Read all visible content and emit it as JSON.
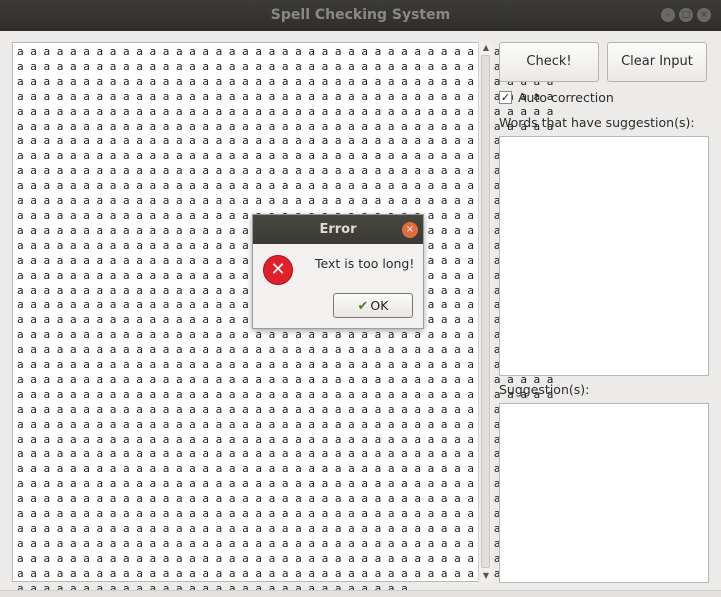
{
  "window": {
    "title": "Spell Checking System",
    "controls": [
      "minimize-icon",
      "maximize-icon",
      "close-icon"
    ]
  },
  "input": {
    "lines": [
      "a a a a a a a a a a a a a a a a a a a a a a a a a a a a a a a a a a a a a a a a a",
      "a a a a a a a a a a a a a a a a a a a a a a a a a a a a a a a a a a a a a a a a a",
      "a a a a a a a a a a a a a a a a a a a a a a a a a a a a a a a a a a a a a a a a a",
      "a a a a a a a a a a a a a a a a a a a a a a a a a a a a a a a a a a a a a a a a a",
      "a a a a a a a a a a a a a a a a a a a a a a a a a a a a a a a a a a a a a a a a a",
      "a a a a a a a a a a a a a a a a a a a a a a a a a a a a a a a a a a a a a a a a a",
      "a a a a a a a a a a a a a a a a a a a a a a a a a a a a a a a a a a a a a a a a a",
      "a a a a a a a a a a a a a a a a a a a a a a a a a a a a a a a a a a a a a a a a a",
      "a a a a a a a a a a a a a a a a a a a a a a a a a a a a a a a a a a a a a a a a a",
      "a a a a a a a a a a a a a a a a a a a a a a a a a a a a a a a a a a a a a a a a a",
      "a a a a a a a a a a a a a a a a a a a a a a a a a a a a a a a a a a a a a a a a a",
      "a a a a a a a a a a a a a a a a a a a a a a a a a a a a a a a a a a a a a a a a a",
      "a a a a a a a a a a a a a a a a a a a a a a a a a a a a a a a a a a a a a a a a a",
      "a a a a a a a a a a a a a a a a a a a a a a a a a a a a a a a a a a a a a a a a a",
      "a a a a a a a a a a a a a a a a a a a a a a a a a a a a a a a a a a a a a a a a a",
      "a a a a a a a a a a a a a a a a a a a a a a a a a a a a a a a a a a a a a a a a a",
      "a a a a a a a a a a a a a a a a a a a a a a a a a a a a a a a a a a a a a a a a a",
      "a a a a a a a a a a a a a a a a a a a a a a a a a a a a a a a a a a a a a a a a a",
      "a a a a a a a a a a a a a a a a a a a a a a a a a a a a a a a a a a a a a a a a a",
      "a a a a a a a a a a a a a a a a a a a a a a a a a a a a a a a a a a a a a a a a a",
      "a a a a a a a a a a a a a a a a a a a a a a a a a a a a a a a a a a a a a a a a a",
      "a a a a a a a a a a a a a a a a a a a a a a a a a a a a a a a a a a a a a a a a a",
      "a a a a a a a a a a a a a a a a a a a a a a a a a a a a a a a a a a a a a a a a a",
      "a a a a a a a a a a a a a a a a a a a a a a a a a a a a a a a a a a a a a a a a a",
      "a a a a a a a a a a a a a a a a a a a a a a a a a a a a a a a a a a a a a a a a a",
      "a a a a a a a a a a a a a a a a a a a a a a a a a a a a a a a a a a a a a a a a a",
      "a a a a a a a a a a a a a a a a a a a a a a a a a a a a a a a a a a a a a a a a a",
      "a a a a a a a a a a a a a a a a a a a a a a a a a a a a a a a a a a a a a a a a a",
      "a a a a a a a a a a a a a a a a a a a a a a a a a a a a a a a a a a a a a a a a a",
      "a a a a a a a a a a a a a a a a a a a a a a a a a a a a a a a a a a a a a a a a a",
      "a a a a a a a a a a a a a a a a a a a a a a a a a a a a a a a a a a a a a a a a a",
      "a a a a a a a a a a a a a a a a a a a a a a a a a a a a a a a a a a a a a a a a a",
      "a a a a a a a a a a a a a a a a a a a a a a a a a a a a a a a a a a a a a a a a a",
      "a a a a a a a a a a a a a a a a a a a a a a a a a a a a a a a a a a a a a a a a a",
      "a a a a a a a a a a a a a a a a a a a a a a a a a a a a a a a a a a a a a a a a a",
      "a a a a a a a a a a a a a a a a a a a a a a a a a a a a a a a a a a a a a a a a a",
      "a a a a a a a a a a a a a a a a a a a a a a a a a a a a a a"
    ]
  },
  "sidebar": {
    "check_button": "Check!",
    "clear_button": "Clear Input",
    "auto_correction_label": "Auto correction",
    "auto_correction_checked": true,
    "words_label": "Words that have suggestion(s):",
    "suggestions_label": "Suggestion(s):"
  },
  "dialog": {
    "title": "Error",
    "message": "Text is too long!",
    "ok_button": "OK",
    "icon": "error-icon"
  }
}
